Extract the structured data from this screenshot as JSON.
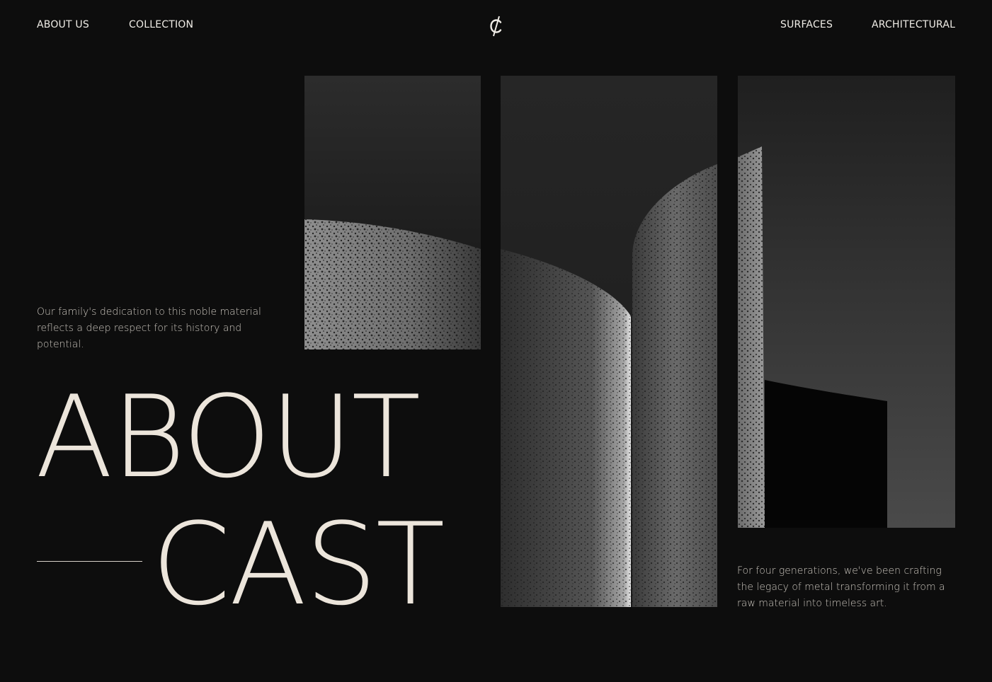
{
  "nav": {
    "left": [
      {
        "label": "ABOUT US"
      },
      {
        "label": "COLLECTION"
      }
    ],
    "right": [
      {
        "label": "SURFACES"
      },
      {
        "label": "ARCHITECTURAL"
      }
    ],
    "logo_icon": "cent-sign-logo"
  },
  "hero": {
    "intro": "Our family's dedication to this noble material reflects a deep respect for its history and potential.",
    "title_line1": "ABOUT",
    "title_line2": "CAST",
    "side_text": "For four generations, we've been crafting the legacy of metal transforming it from a raw material into timeless art."
  },
  "colors": {
    "background": "#0d0d0d",
    "headline": "#ece5db"
  }
}
